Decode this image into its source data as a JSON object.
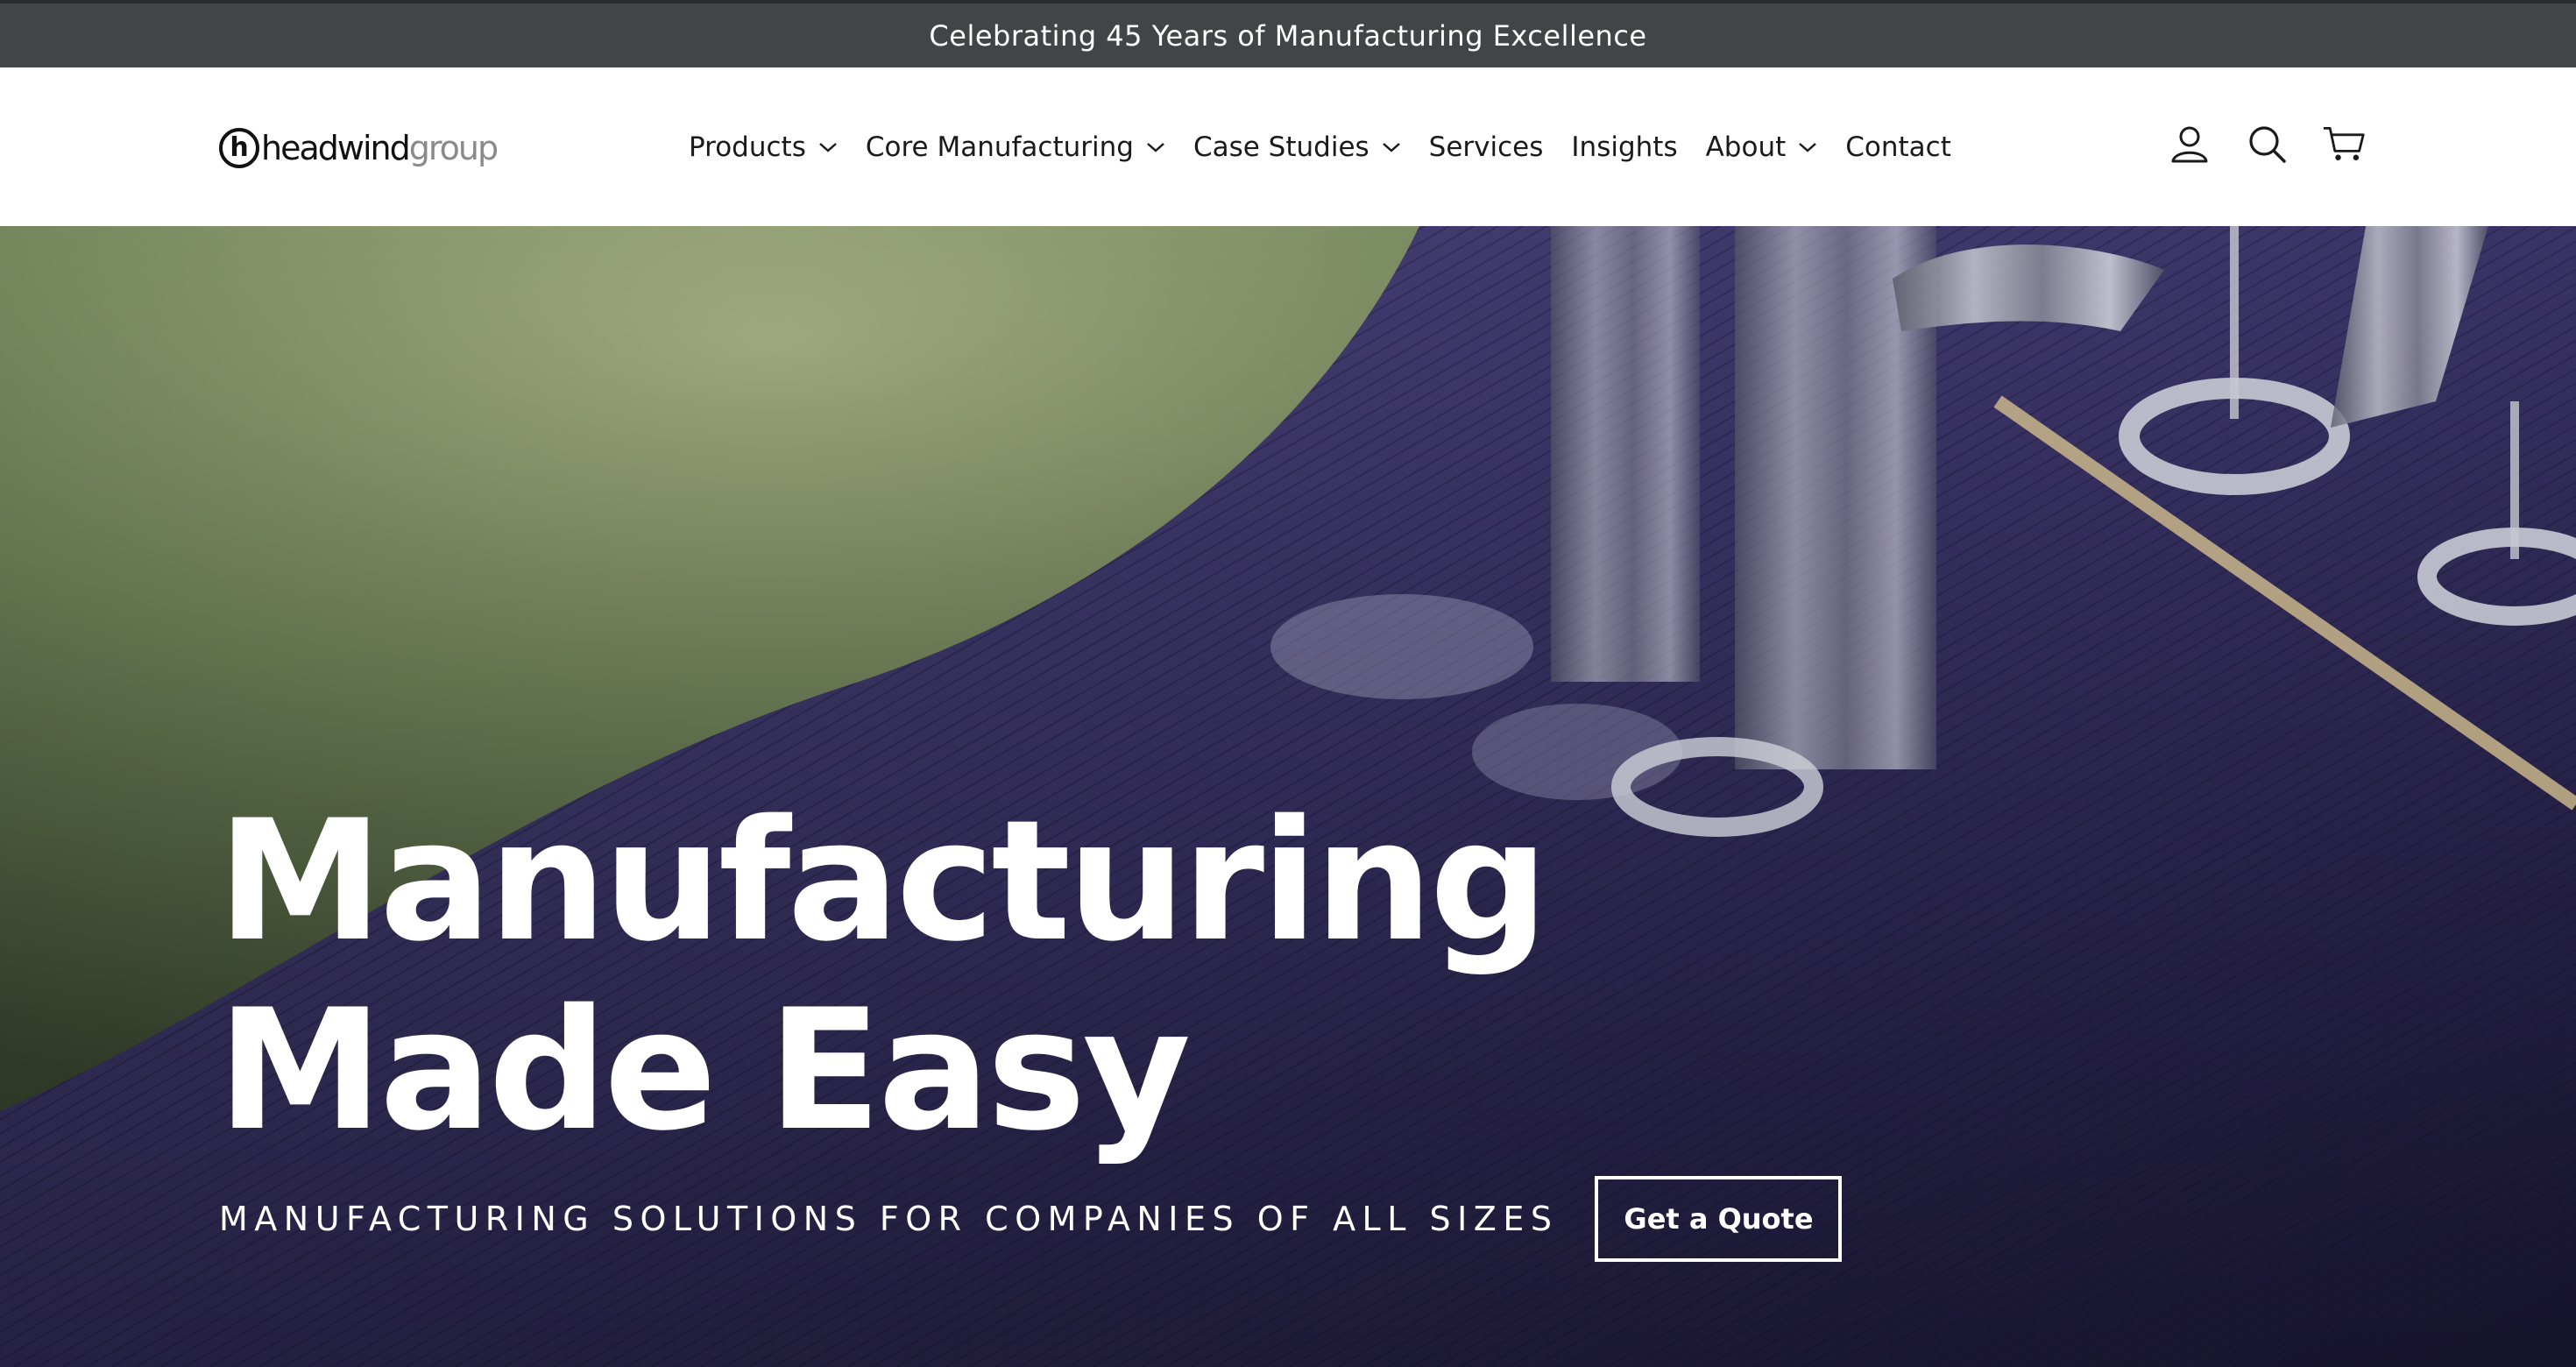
{
  "announcement": {
    "text": "Celebrating 45 Years of Manufacturing Excellence"
  },
  "header": {
    "logo": {
      "primary": "headwind",
      "secondary": "group",
      "mark_letter": "h"
    },
    "nav": [
      {
        "label": "Products",
        "has_dropdown": true
      },
      {
        "label": "Core Manufacturing",
        "has_dropdown": true
      },
      {
        "label": "Case Studies",
        "has_dropdown": true
      },
      {
        "label": "Services",
        "has_dropdown": false
      },
      {
        "label": "Insights",
        "has_dropdown": false
      },
      {
        "label": "About",
        "has_dropdown": true
      },
      {
        "label": "Contact",
        "has_dropdown": false
      }
    ],
    "icons": [
      "account-icon",
      "search-icon",
      "cart-icon"
    ]
  },
  "hero": {
    "title_line1": "Manufacturing",
    "title_line2": "Made Easy",
    "subtitle": "MANUFACTURING SOLUTIONS FOR COMPANIES OF ALL SIZES",
    "cta_label": "Get a Quote",
    "background": "embroidery-machine-on-purple-fabric"
  },
  "colors": {
    "announcement_bg": "#414547",
    "hero_fabric": "#3b3468",
    "hero_green": "#7d8f5e",
    "text_on_dark": "#ffffff"
  }
}
